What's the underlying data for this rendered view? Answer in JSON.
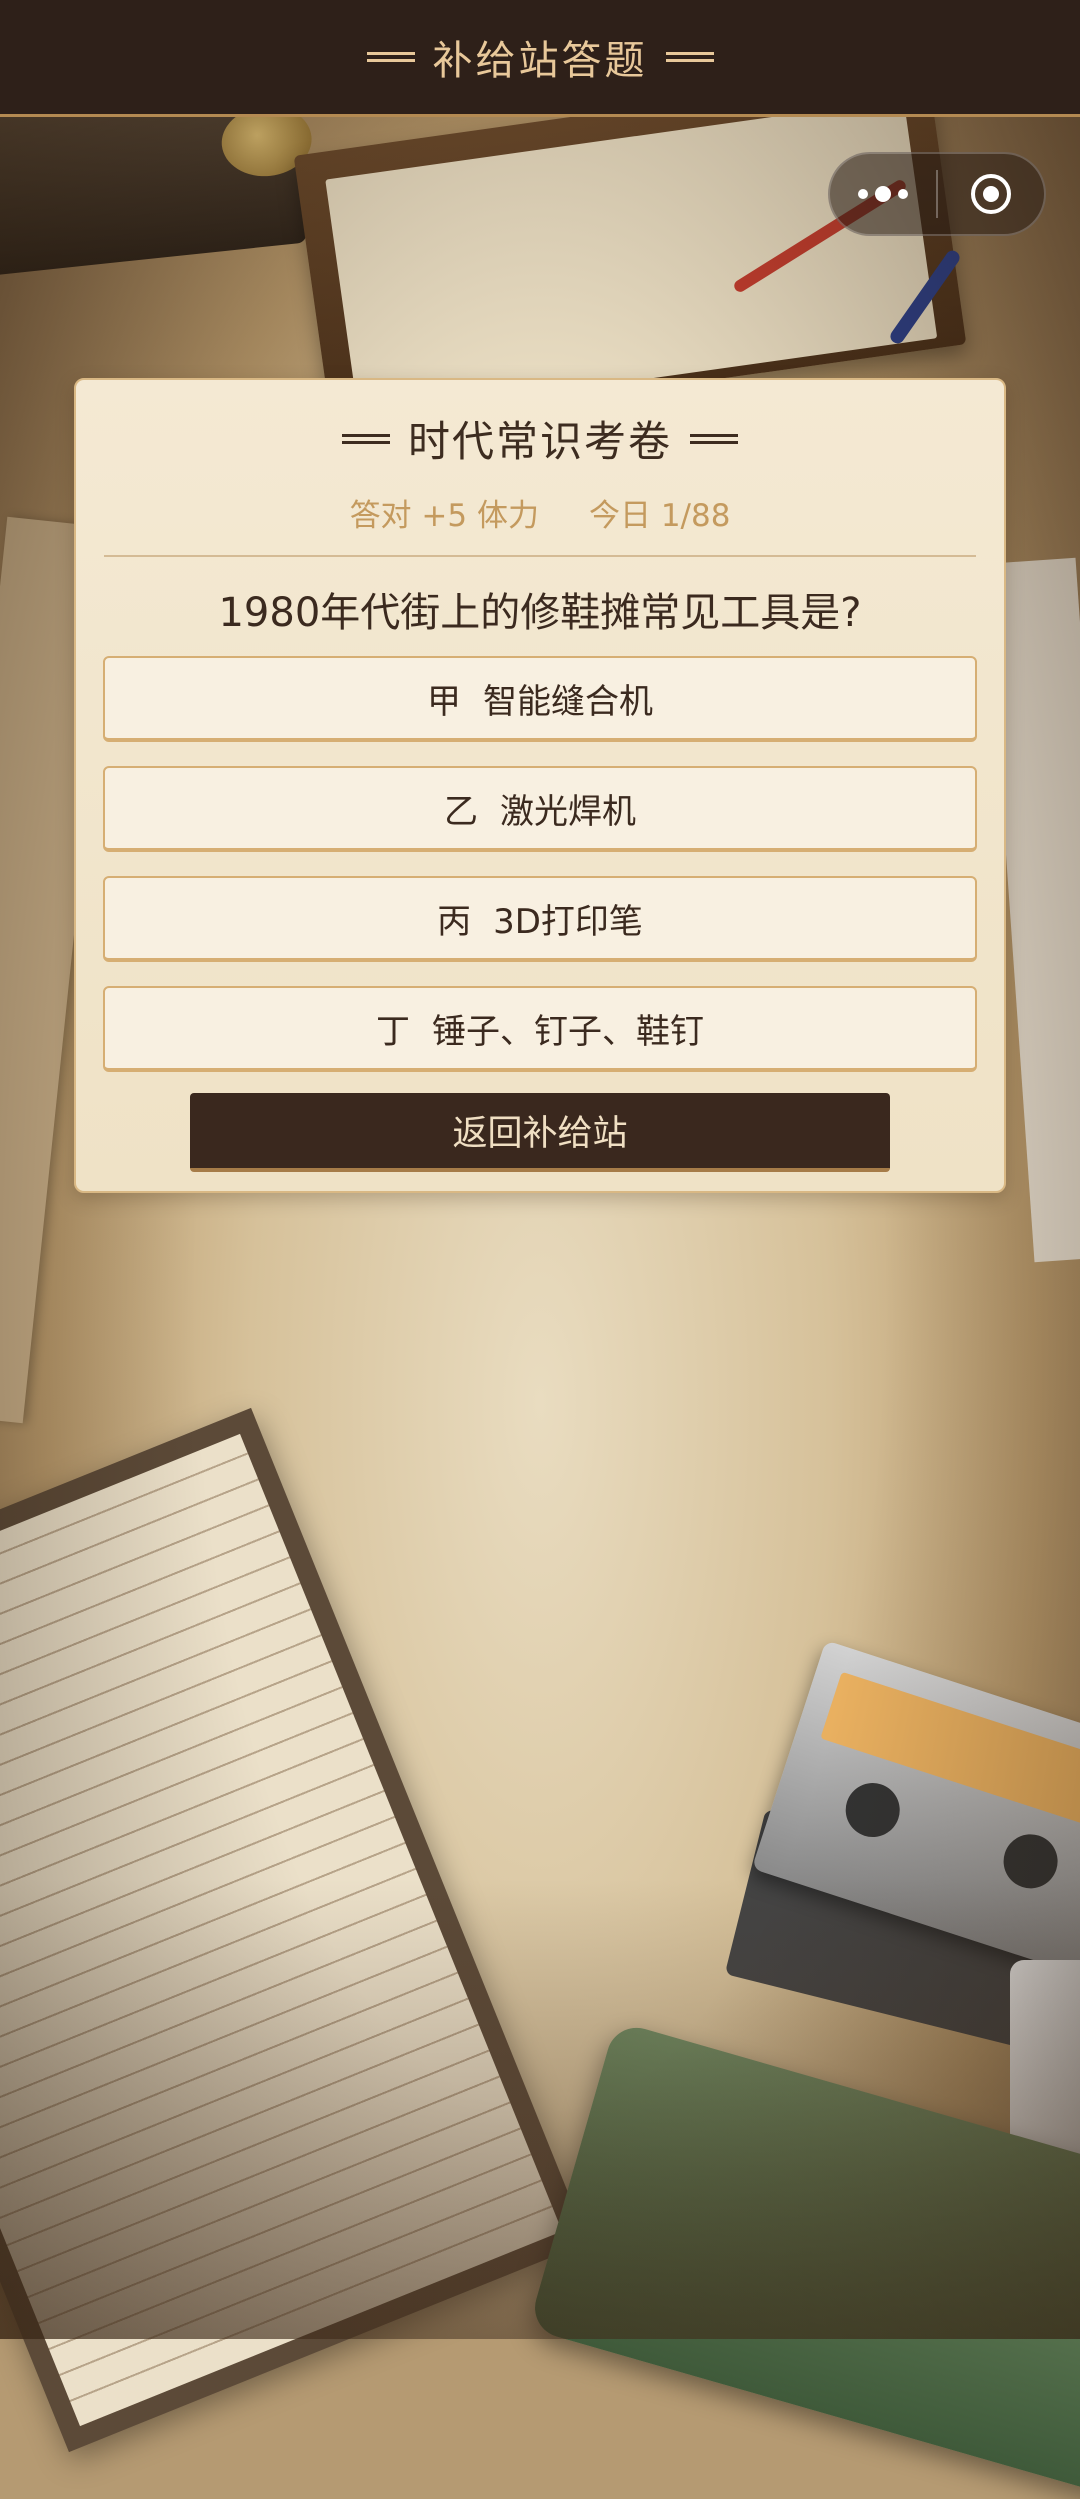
{
  "header": {
    "title": "补给站答题"
  },
  "capsule": {
    "menu_icon": "more-dots-icon",
    "close_icon": "target-circle-icon"
  },
  "quiz": {
    "title": "时代常识考卷",
    "reward": "答对 +5 体力",
    "progress": "今日 1/88",
    "question": "1980年代街上的修鞋摊常见工具是?",
    "options": [
      {
        "key": "甲",
        "text": "智能缝合机"
      },
      {
        "key": "乙",
        "text": "激光焊机"
      },
      {
        "key": "丙",
        "text": "3D打印笔"
      },
      {
        "key": "丁",
        "text": "锤子、钉子、鞋钉"
      }
    ],
    "back_label": "返回补给站"
  },
  "colors": {
    "topbar_bg": "#2e2019",
    "accent_gold": "#e8c89a",
    "card_bg": "#f4e9d3",
    "reward_text": "#c49a5e",
    "button_dark": "#3a281e"
  }
}
